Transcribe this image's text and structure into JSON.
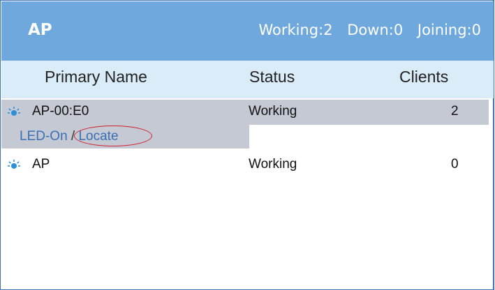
{
  "header": {
    "title": "AP",
    "working": "Working:2",
    "down": "Down:0",
    "joining": "Joining:0"
  },
  "columns": {
    "name": "Primary Name",
    "status": "Status",
    "clients": "Clients"
  },
  "rows": [
    {
      "name": "AP-00:E0",
      "status": "Working",
      "clients": "2",
      "icon": "ap-light-icon",
      "actions": {
        "led": "LED-On",
        "separator": "/",
        "locate": "Locate"
      }
    },
    {
      "name": "AP",
      "status": "Working",
      "clients": "0",
      "icon": "ap-light-icon"
    }
  ],
  "colors": {
    "header_bg": "#6fa8dd",
    "column_header_bg": "#daecf8",
    "selected_row_bg": "#c4c9d4",
    "link": "#3a6fb5",
    "annotation": "#d0202a"
  }
}
